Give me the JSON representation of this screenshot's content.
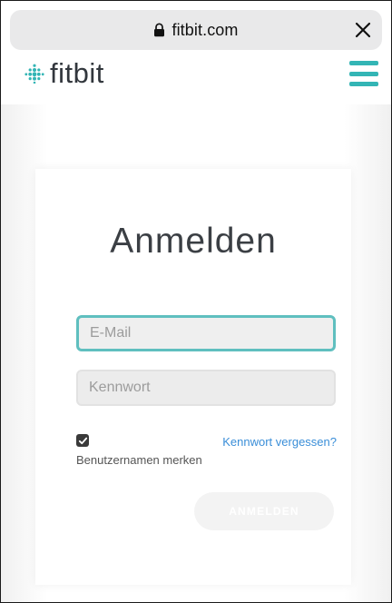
{
  "browser": {
    "url": "fitbit.com",
    "icons": {
      "lock": "lock-icon",
      "close": "close-icon"
    }
  },
  "header": {
    "logo_text": "fitbit",
    "icons": {
      "logo": "fitbit-logo-icon",
      "menu": "hamburger-menu-icon"
    },
    "accent_color": "#33b5b5"
  },
  "login": {
    "title": "Anmelden",
    "email_placeholder": "E-Mail",
    "password_placeholder": "Kennwort",
    "remember_checked": true,
    "remember_label": "Benutzernamen merken",
    "forgot_link": "Kennwort vergessen?",
    "submit_label": "ANMELDEN",
    "link_color": "#3a8ed8",
    "focus_color": "#5fbfbf"
  }
}
